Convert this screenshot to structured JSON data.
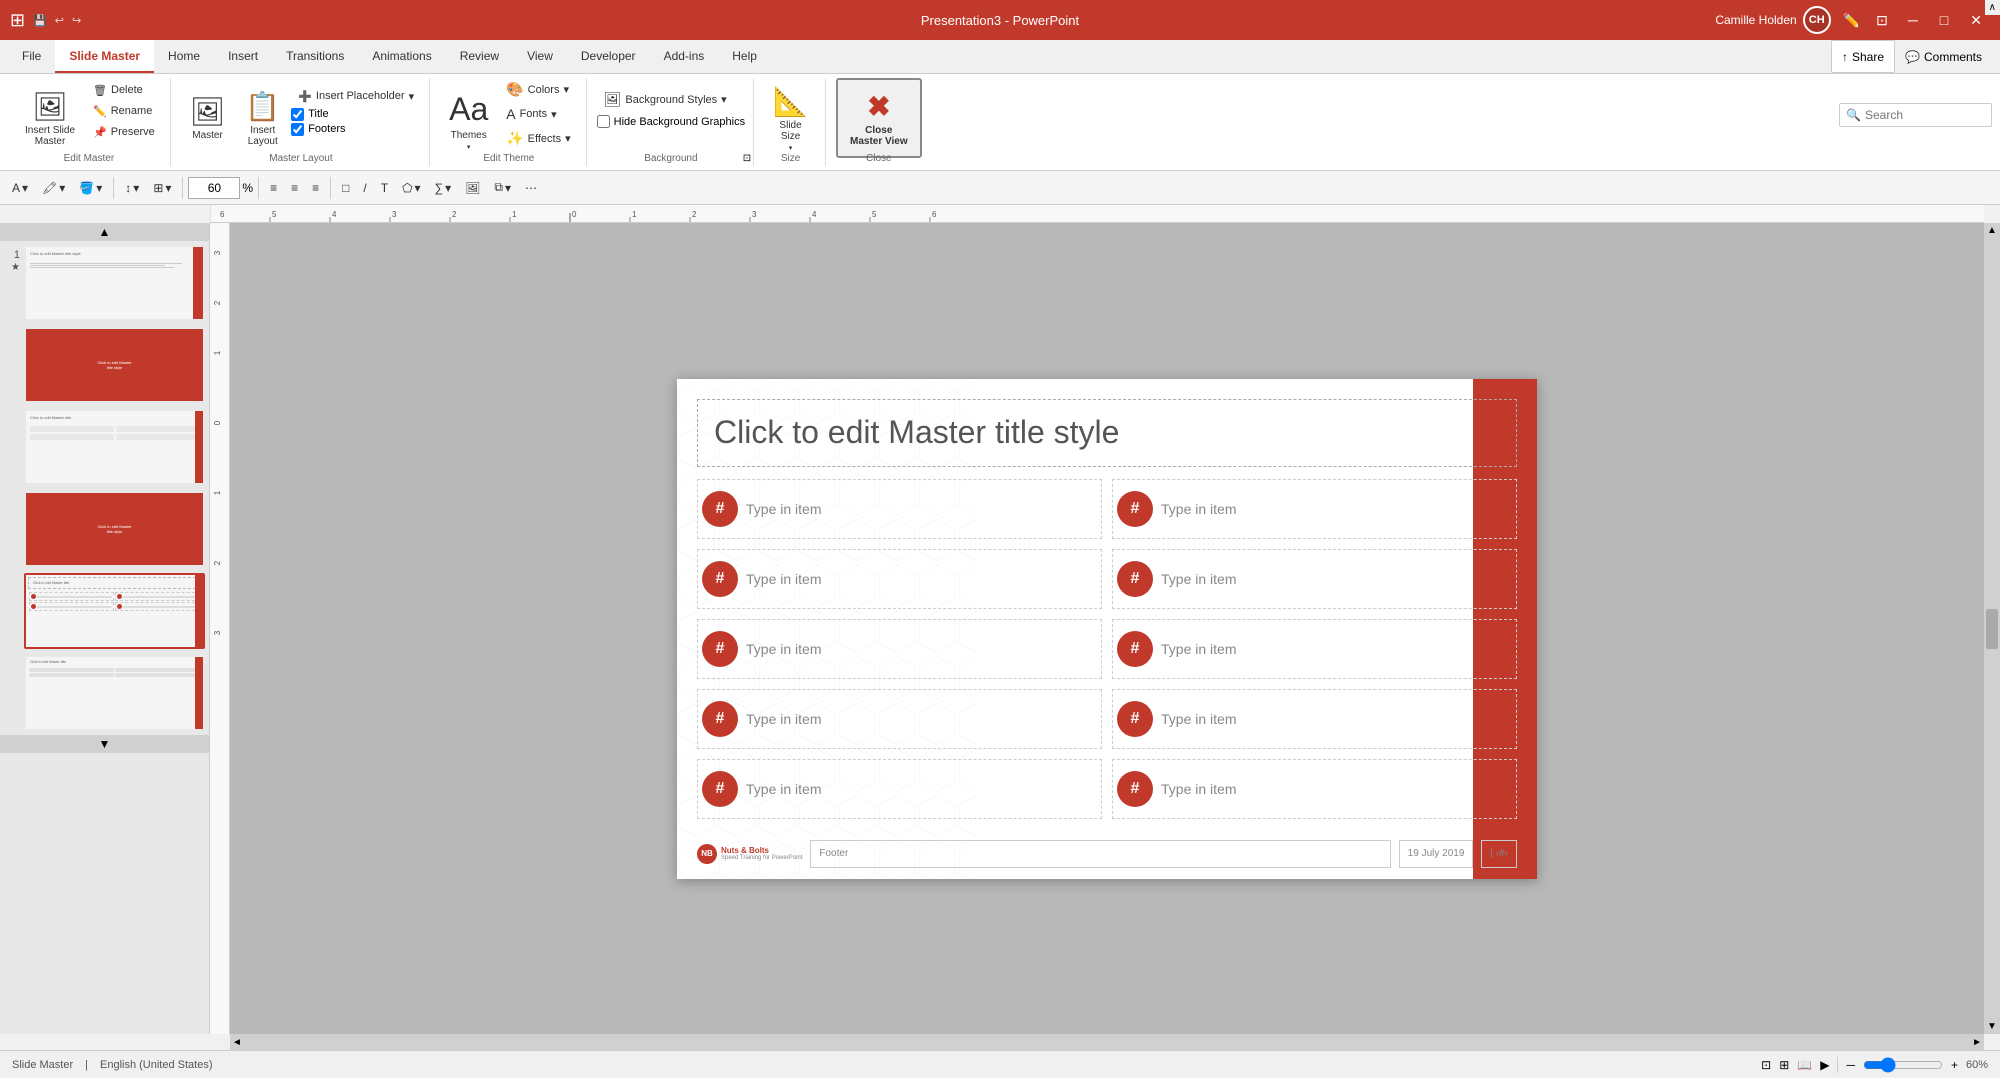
{
  "titleBar": {
    "title": "Presentation3 - PowerPoint",
    "userName": "Camille Holden",
    "userInitials": "CH"
  },
  "tabs": [
    {
      "id": "file",
      "label": "File"
    },
    {
      "id": "slide-master",
      "label": "Slide Master",
      "active": true
    },
    {
      "id": "home",
      "label": "Home"
    },
    {
      "id": "insert",
      "label": "Insert"
    },
    {
      "id": "transitions",
      "label": "Transitions"
    },
    {
      "id": "animations",
      "label": "Animations"
    },
    {
      "id": "review",
      "label": "Review"
    },
    {
      "id": "view",
      "label": "View"
    },
    {
      "id": "developer",
      "label": "Developer"
    },
    {
      "id": "add-ins",
      "label": "Add-ins"
    },
    {
      "id": "help",
      "label": "Help"
    }
  ],
  "ribbon": {
    "groups": [
      {
        "id": "edit-master",
        "label": "Edit Master",
        "buttons": [
          {
            "id": "insert-slide-master",
            "label": "Insert Slide\nMaster",
            "icon": "🖼"
          },
          {
            "id": "insert-layout",
            "label": "Insert\nLayout",
            "icon": "📄"
          },
          {
            "id": "delete",
            "label": "Delete",
            "icon": "🗑"
          },
          {
            "id": "rename",
            "label": "Rename",
            "icon": "✏️"
          },
          {
            "id": "preserve",
            "label": "Preserve",
            "icon": "📌"
          }
        ]
      },
      {
        "id": "master-layout",
        "label": "Master Layout",
        "buttons": [
          {
            "id": "master",
            "label": "Master",
            "icon": "🖼"
          },
          {
            "id": "insert-layout2",
            "label": "Insert\nLayout",
            "icon": "📋"
          },
          {
            "id": "insert-placeholder",
            "label": "Insert\nPlaceholder",
            "icon": "➕"
          }
        ],
        "checkboxes": [
          {
            "id": "title",
            "label": "Title",
            "checked": true
          },
          {
            "id": "footers",
            "label": "Footers",
            "checked": true
          }
        ]
      },
      {
        "id": "edit-theme",
        "label": "Edit Theme",
        "buttons": [
          {
            "id": "themes",
            "label": "Themes",
            "icon": "🎨"
          },
          {
            "id": "colors",
            "label": "Colors",
            "icon": "🎨"
          },
          {
            "id": "fonts",
            "label": "Fonts",
            "icon": "A"
          },
          {
            "id": "effects",
            "label": "Effects",
            "icon": "✨"
          }
        ]
      },
      {
        "id": "background",
        "label": "Background",
        "buttons": [
          {
            "id": "background-styles",
            "label": "Background Styles",
            "icon": "🖼"
          },
          {
            "id": "hide-bg-graphics",
            "label": "Hide Background Graphics",
            "checkbox": true
          }
        ]
      },
      {
        "id": "size",
        "label": "Size",
        "buttons": [
          {
            "id": "slide-size",
            "label": "Slide\nSize",
            "icon": "📐"
          }
        ]
      },
      {
        "id": "close",
        "label": "Close",
        "buttons": [
          {
            "id": "close-master-view",
            "label": "Close\nMaster View",
            "icon": "✖"
          }
        ]
      }
    ]
  },
  "toolbar": {
    "zoom": "60",
    "zoomUnit": "%"
  },
  "slides": [
    {
      "num": "1",
      "star": true,
      "active": false,
      "type": "main"
    },
    {
      "num": "",
      "star": false,
      "active": false,
      "type": "red"
    },
    {
      "num": "",
      "star": false,
      "active": false,
      "type": "list-light"
    },
    {
      "num": "",
      "star": false,
      "active": false,
      "type": "red-full"
    },
    {
      "num": "",
      "star": false,
      "active": true,
      "type": "list-active"
    },
    {
      "num": "",
      "star": false,
      "active": false,
      "type": "list-light2"
    }
  ],
  "slide": {
    "titlePlaceholder": "Click to edit Master title style",
    "items": [
      {
        "col": 1,
        "row": 1,
        "hash": "#",
        "text": "Type in item"
      },
      {
        "col": 2,
        "row": 1,
        "hash": "#",
        "text": "Type in item"
      },
      {
        "col": 1,
        "row": 2,
        "hash": "#",
        "text": "Type in item"
      },
      {
        "col": 2,
        "row": 2,
        "hash": "#",
        "text": "Type in item"
      },
      {
        "col": 1,
        "row": 3,
        "hash": "#",
        "text": "Type in item"
      },
      {
        "col": 2,
        "row": 3,
        "hash": "#",
        "text": "Type in item"
      },
      {
        "col": 1,
        "row": 4,
        "hash": "#",
        "text": "Type in item"
      },
      {
        "col": 2,
        "row": 4,
        "hash": "#",
        "text": "Type in item"
      },
      {
        "col": 1,
        "row": 5,
        "hash": "#",
        "text": "Type in item"
      },
      {
        "col": 2,
        "row": 5,
        "hash": "#",
        "text": "Type in item"
      }
    ],
    "footer": {
      "logoText": "Nuts & Bolts",
      "logoSubtext": "Speed Training for PowerPoint",
      "footerLabel": "Footer",
      "date": "19 July 2019"
    }
  },
  "statusBar": {
    "view": "Slide Master",
    "language": "English (United States)",
    "zoom": "60%"
  },
  "search": {
    "placeholder": "Search"
  }
}
